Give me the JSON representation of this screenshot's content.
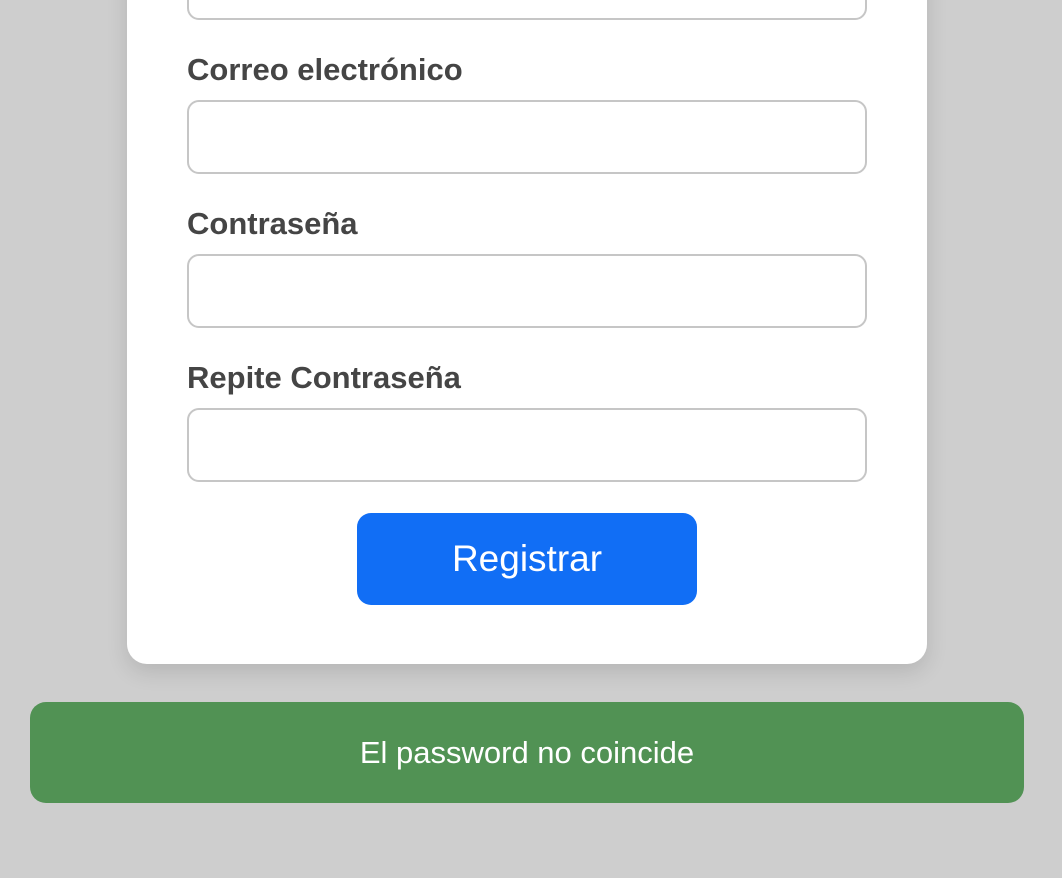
{
  "form": {
    "fields": [
      {
        "label": "",
        "value": "",
        "placeholder": ""
      },
      {
        "label": "Correo electrónico",
        "value": "",
        "placeholder": ""
      },
      {
        "label": "Contraseña",
        "value": "",
        "placeholder": ""
      },
      {
        "label": "Repite Contraseña",
        "value": "",
        "placeholder": ""
      }
    ],
    "submit_label": "Registrar"
  },
  "alert": {
    "message": "El password no coincide"
  },
  "colors": {
    "background": "#cecece",
    "card": "#ffffff",
    "primary": "#116ef5",
    "alert": "#519254",
    "label": "#454545",
    "input_border": "#c6c6c6"
  }
}
